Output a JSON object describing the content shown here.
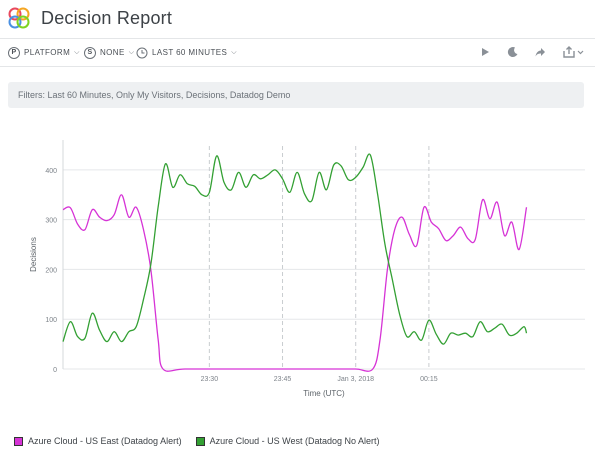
{
  "header": {
    "title": "Decision Report"
  },
  "toolbar": {
    "platform": {
      "icon_letter": "P",
      "label": "PLATFORM"
    },
    "sample": {
      "icon_letter": "S",
      "label": "NONE"
    },
    "time": {
      "label": "LAST 60 MINUTES"
    },
    "icons": [
      "play-icon",
      "moon-icon",
      "share-arrow-icon",
      "export-icon"
    ]
  },
  "filters": {
    "text": "Filters:  Last 60 Minutes,  Only My Visitors,  Decisions,  Datadog Demo"
  },
  "chart_data": {
    "type": "line",
    "xlabel": "Time (UTC)",
    "ylabel": "Decisions",
    "ylim": [
      0,
      460
    ],
    "xlim": [
      0,
      107
    ],
    "x_ticks": [
      {
        "x": 30,
        "label": "23:30"
      },
      {
        "x": 45,
        "label": "23:45"
      },
      {
        "x": 60,
        "label": "Jan 3, 2018"
      },
      {
        "x": 75,
        "label": "00:15"
      }
    ],
    "y_ticks": [
      0,
      100,
      200,
      300,
      400
    ],
    "x_unit": "minutes since 23:00 UTC",
    "grid": true,
    "dashed_vlines_x": [
      30,
      45,
      60,
      75
    ],
    "legend_position": "bottom-left",
    "colors": {
      "us_east": "#d633d6",
      "us_west": "#33a033",
      "grid": "#e5e7ea",
      "axis_text": "#7d838a"
    },
    "series": [
      {
        "name": "Azure Cloud - US East (Datadog Alert)",
        "color": "#d633d6",
        "points": [
          [
            0,
            320
          ],
          [
            1.5,
            324
          ],
          [
            3,
            291
          ],
          [
            4.5,
            280
          ],
          [
            6,
            320
          ],
          [
            7.5,
            305
          ],
          [
            9,
            298
          ],
          [
            10.5,
            310
          ],
          [
            12,
            350
          ],
          [
            13.5,
            305
          ],
          [
            15,
            325
          ],
          [
            16.5,
            280
          ],
          [
            18,
            200
          ],
          [
            19.5,
            60
          ],
          [
            20.5,
            0
          ],
          [
            25,
            0
          ],
          [
            35,
            0
          ],
          [
            45,
            0
          ],
          [
            55,
            0
          ],
          [
            60,
            0
          ],
          [
            63.5,
            0
          ],
          [
            65,
            60
          ],
          [
            66.5,
            200
          ],
          [
            68,
            280
          ],
          [
            69.5,
            305
          ],
          [
            71,
            270
          ],
          [
            72.5,
            248
          ],
          [
            74,
            325
          ],
          [
            75.5,
            295
          ],
          [
            77,
            282
          ],
          [
            78.5,
            258
          ],
          [
            80,
            268
          ],
          [
            81.5,
            285
          ],
          [
            83,
            262
          ],
          [
            84.5,
            260
          ],
          [
            86,
            340
          ],
          [
            87.5,
            302
          ],
          [
            89,
            335
          ],
          [
            90.5,
            268
          ],
          [
            92,
            295
          ],
          [
            93.5,
            240
          ],
          [
            95,
            325
          ]
        ]
      },
      {
        "name": "Azure Cloud - US West (Datadog No Alert)",
        "color": "#33a033",
        "points": [
          [
            0,
            55
          ],
          [
            1.5,
            95
          ],
          [
            3,
            65
          ],
          [
            4.5,
            62
          ],
          [
            6,
            112
          ],
          [
            7.5,
            78
          ],
          [
            9,
            55
          ],
          [
            10.5,
            75
          ],
          [
            12,
            55
          ],
          [
            13.5,
            75
          ],
          [
            15,
            85
          ],
          [
            16.5,
            140
          ],
          [
            18,
            210
          ],
          [
            19.5,
            325
          ],
          [
            21,
            412
          ],
          [
            22.5,
            365
          ],
          [
            24,
            390
          ],
          [
            25.5,
            372
          ],
          [
            27,
            367
          ],
          [
            28.5,
            350
          ],
          [
            30,
            355
          ],
          [
            31.5,
            428
          ],
          [
            33,
            375
          ],
          [
            34.5,
            360
          ],
          [
            36,
            395
          ],
          [
            37.5,
            365
          ],
          [
            39,
            390
          ],
          [
            40.5,
            382
          ],
          [
            42,
            390
          ],
          [
            43.5,
            400
          ],
          [
            45,
            382
          ],
          [
            46.5,
            355
          ],
          [
            48,
            395
          ],
          [
            49.5,
            352
          ],
          [
            51,
            338
          ],
          [
            52.5,
            395
          ],
          [
            54,
            360
          ],
          [
            55.5,
            410
          ],
          [
            57,
            408
          ],
          [
            58.5,
            380
          ],
          [
            60,
            385
          ],
          [
            61.5,
            405
          ],
          [
            63,
            430
          ],
          [
            64.5,
            350
          ],
          [
            66,
            250
          ],
          [
            67.5,
            180
          ],
          [
            69,
            110
          ],
          [
            70.5,
            65
          ],
          [
            72,
            75
          ],
          [
            73.5,
            58
          ],
          [
            75,
            98
          ],
          [
            76.5,
            70
          ],
          [
            78,
            50
          ],
          [
            79.5,
            72
          ],
          [
            81,
            68
          ],
          [
            82.5,
            72
          ],
          [
            84,
            65
          ],
          [
            85.5,
            95
          ],
          [
            87,
            75
          ],
          [
            88.5,
            82
          ],
          [
            90,
            90
          ],
          [
            91.5,
            68
          ],
          [
            93,
            72
          ],
          [
            94.5,
            85
          ],
          [
            95,
            72
          ]
        ]
      }
    ]
  }
}
